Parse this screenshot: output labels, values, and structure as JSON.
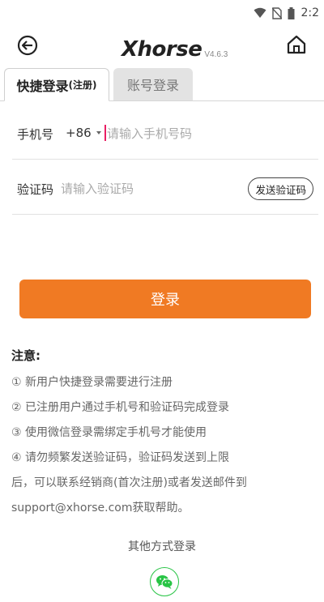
{
  "status_bar": {
    "time": "2:2"
  },
  "header": {
    "logo_text": "Xhorse",
    "version": "V4.6.3"
  },
  "tabs": [
    {
      "label_main": "快捷登录",
      "label_note": "(注册)",
      "active": true
    },
    {
      "label": "账号登录",
      "active": false
    }
  ],
  "phone_row": {
    "label": "手机号",
    "country_code": "+86",
    "placeholder": "请输入手机号码",
    "value": ""
  },
  "code_row": {
    "label": "验证码",
    "placeholder": "请输入验证码",
    "value": "",
    "send_button": "发送验证码"
  },
  "login_button": "登录",
  "notes": {
    "title": "注意:",
    "lines": [
      "① 新用户快捷登录需要进行注册",
      "② 已注册用户通过手机号和验证码完成登录",
      "③ 使用微信登录需绑定手机号才能使用",
      "④ 请勿频繁发送验证码，验证码发送到上限",
      "后，可以联系经销商(首次注册)或者发送邮件到",
      "support@xhorse.com获取帮助。"
    ]
  },
  "other_login": {
    "title": "其他方式登录",
    "wechat_icon": "wechat-icon"
  },
  "colors": {
    "accent": "#f07a23",
    "wechat": "#28c445",
    "caret": "#e91e63"
  }
}
